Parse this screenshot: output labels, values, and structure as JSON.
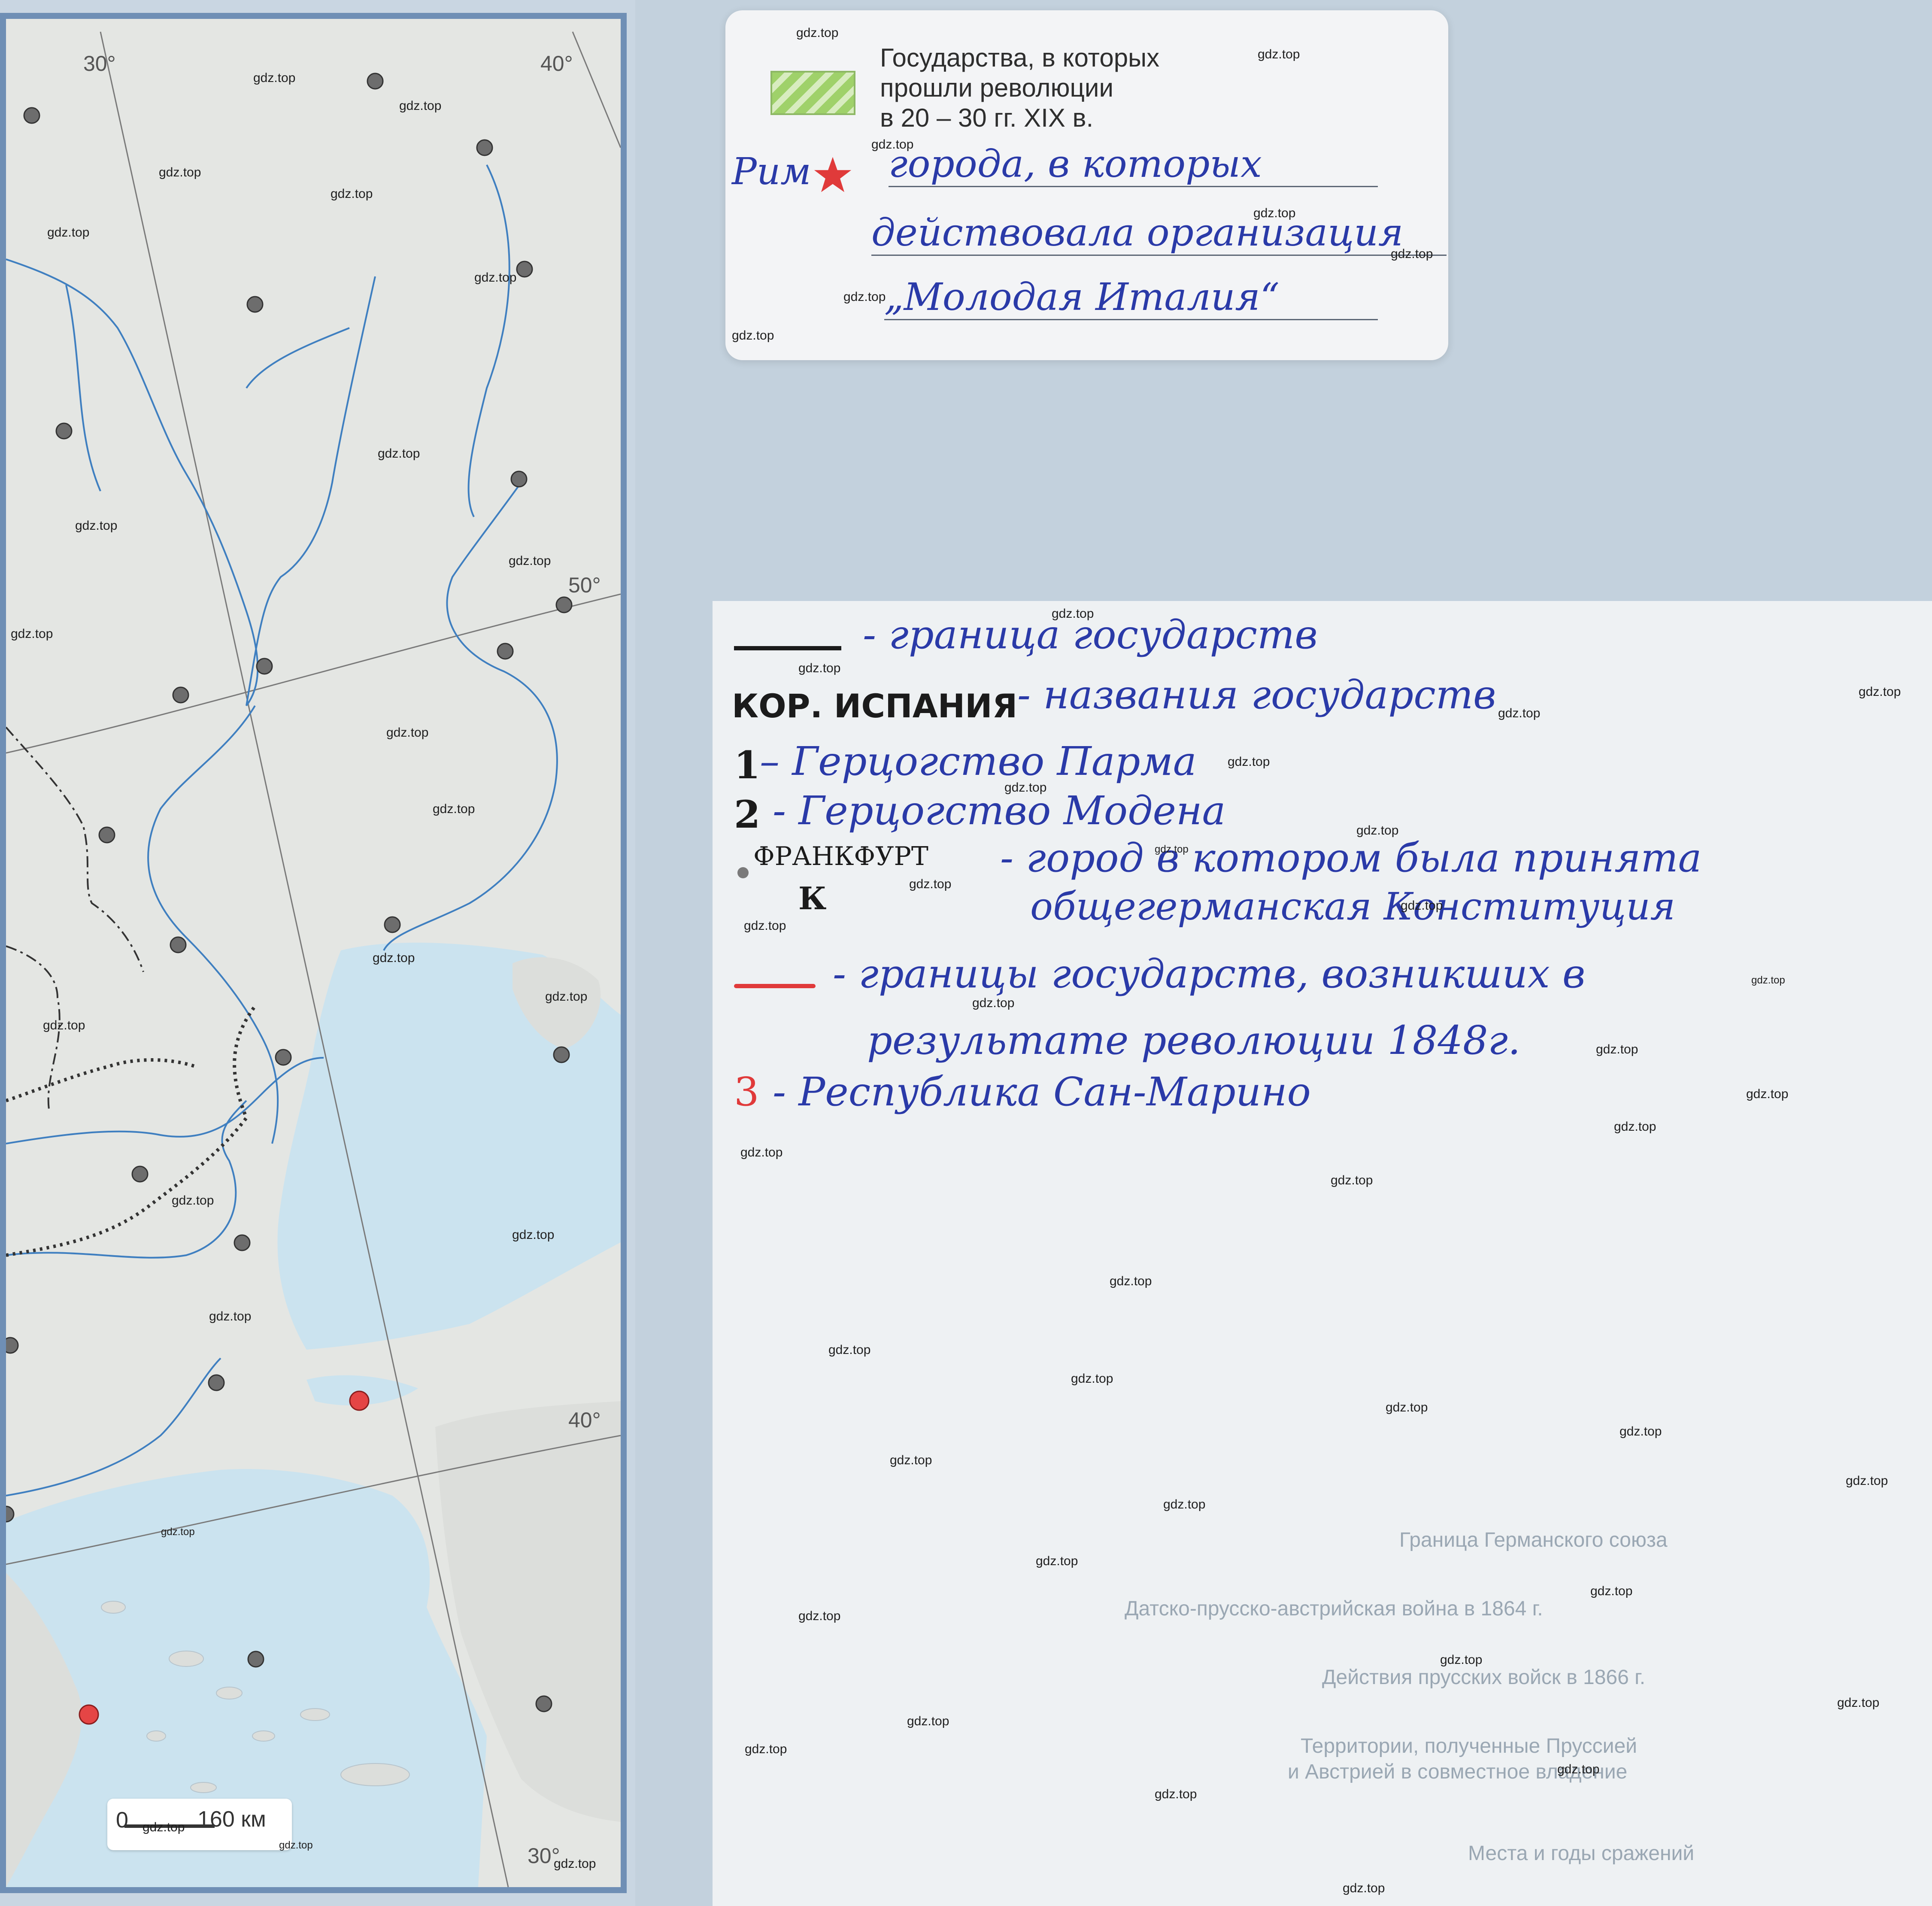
{
  "map": {
    "degree_labels": [
      "30°",
      "40°",
      "50°",
      "40°",
      "30°"
    ],
    "scale": {
      "zero": "0",
      "distance": "160 км"
    }
  },
  "legend_top": {
    "printed_title": "Государства, в которых\nпрошли революции\nв 20 – 30 гг. XIX в.",
    "hand_city": "Рим",
    "hand_line1": "города, в которых",
    "hand_line2": "действовала организация",
    "hand_line3": "„Молодая Италия“"
  },
  "legend_bottom": {
    "line1_text": "- граница государств",
    "line2_caps": "КОР. ИСПАНИЯ",
    "line2_text": "- названия государств",
    "line3_num": "1",
    "line3_text": "– Герцогство Парма",
    "line4_num": "2",
    "line4_text": "- Герцогство Модена",
    "line5_caps": "ФРАНКФУРТ",
    "line5_text": "- город в котором была принята",
    "line5_k": "К",
    "line6_text": "общегерманская Конституция",
    "line7_text": "- границы государств, возникших в",
    "line8_text": "результате революции 1848г.",
    "line9_num": "3",
    "line9_text": "- Республика Сан-Марино"
  },
  "background_print": [
    "Граница Германского союза",
    "Датско-прусско-австрийская война в 1864 г.",
    "Действия прусских войск в 1866 г.",
    "Территории, полученные Пруссией",
    "и Австрией в совместное владение",
    "Места и годы сражений"
  ],
  "watermark": "gdz.top",
  "colors": {
    "sea": "#cbe3ef",
    "river": "#3f7fc0",
    "frame": "#6f8fb5",
    "ink": "#2a3aa8",
    "red": "#e03a3a"
  }
}
